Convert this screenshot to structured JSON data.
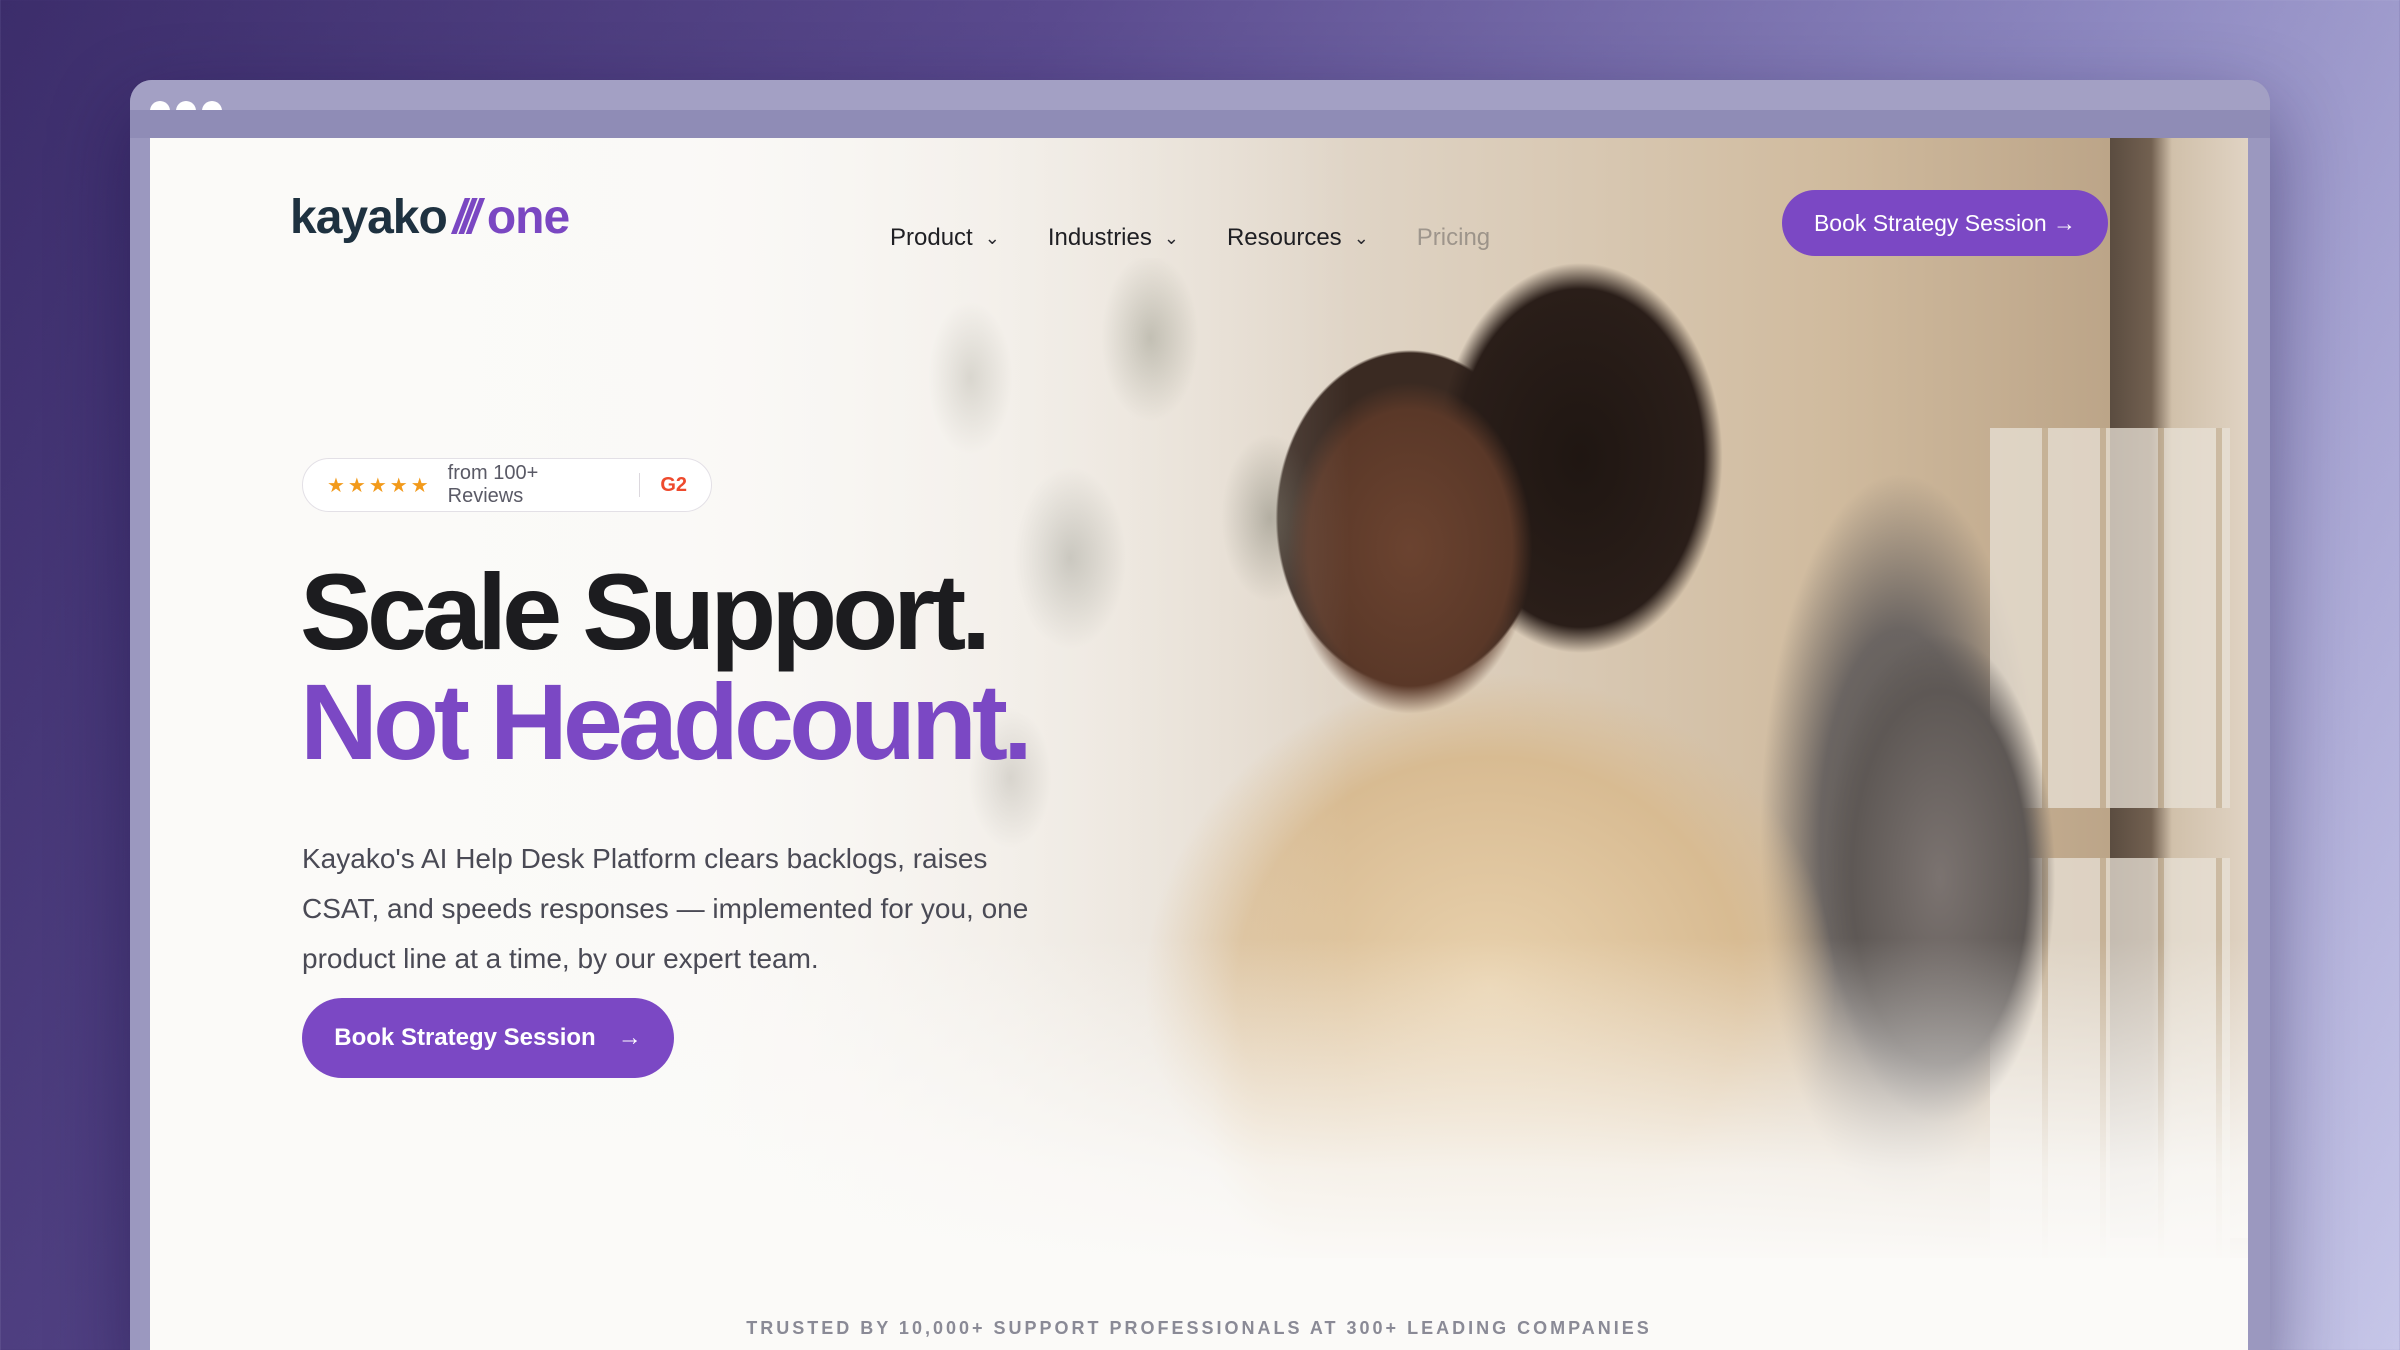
{
  "nav": {
    "logo_word": "kayako",
    "logo_slash": "///",
    "logo_suffix": "one",
    "items": [
      {
        "label": "Product"
      },
      {
        "label": "Industries"
      },
      {
        "label": "Resources"
      },
      {
        "label": "Pricing"
      }
    ],
    "cta_label": "Book Strategy Session →"
  },
  "badge": {
    "stars": "★★★★★",
    "text": "from 100+ Reviews",
    "source": "G2"
  },
  "hero": {
    "headline_line1": "Scale Support.",
    "headline_line2": "Not Headcount.",
    "lead": "Kayako's AI Help Desk Platform clears backlogs, raises CSAT, and speeds responses — implemented for you, one product line at a time, by our expert team.",
    "cta_label": "Book Strategy Session",
    "cta_arrow": "→"
  },
  "trusted": {
    "text": "TRUSTED BY 10,000+ SUPPORT PROFESSIONALS AT 300+ LEADING COMPANIES"
  },
  "colors": {
    "accent": "#7b48c4",
    "logo_dark": "#1e3140",
    "g2": "#ee4a2d",
    "stars": "#f29a1b"
  },
  "icons": {
    "chevron": "chevron-down-icon",
    "arrow": "arrow-right-icon",
    "star": "star-icon"
  }
}
